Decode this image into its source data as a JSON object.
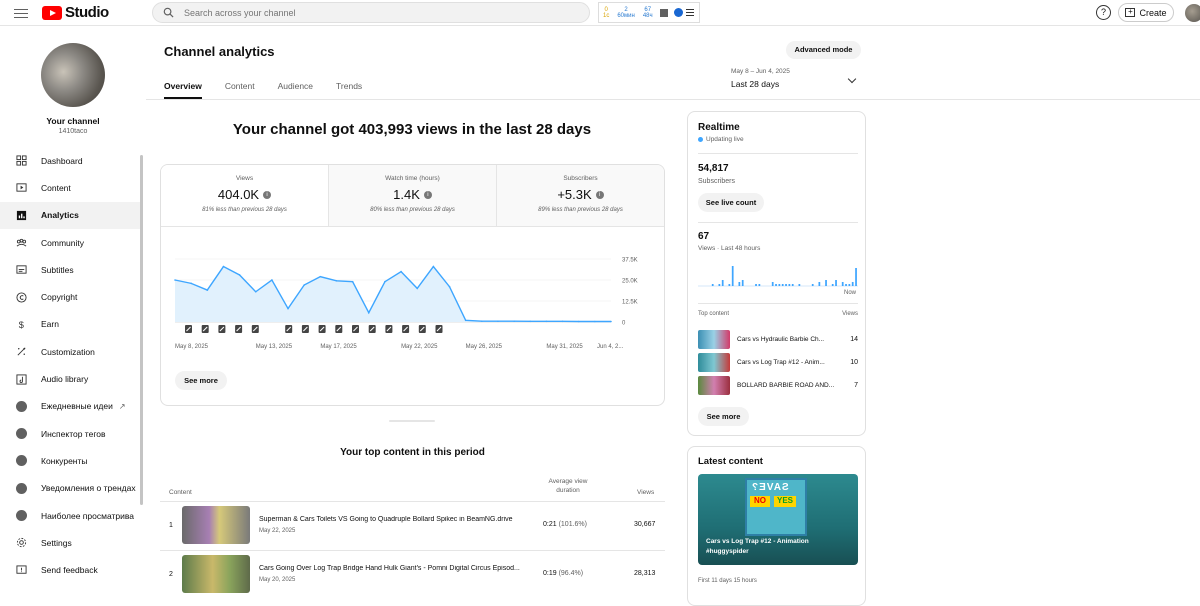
{
  "topbar": {
    "brand": "Studio",
    "search_placeholder": "Search across your channel",
    "ext_stats": [
      {
        "value": "0",
        "label": "1с"
      },
      {
        "value": "2",
        "label": "60мин"
      },
      {
        "value": "67",
        "label": "48ч"
      }
    ],
    "help_label": "?",
    "create_label": "Create"
  },
  "sidebar": {
    "channel_label": "Your channel",
    "channel_handle": "1410taco",
    "items": [
      {
        "label": "Dashboard",
        "icon": "dashboard-icon"
      },
      {
        "label": "Content",
        "icon": "content-icon"
      },
      {
        "label": "Analytics",
        "icon": "analytics-icon",
        "active": true
      },
      {
        "label": "Community",
        "icon": "community-icon"
      },
      {
        "label": "Subtitles",
        "icon": "subtitles-icon"
      },
      {
        "label": "Copyright",
        "icon": "copyright-icon"
      },
      {
        "label": "Earn",
        "icon": "earn-icon"
      },
      {
        "label": "Customization",
        "icon": "customization-icon"
      },
      {
        "label": "Audio library",
        "icon": "audio-library-icon"
      },
      {
        "label": "Ежедневные идеи",
        "icon": "extension-icon"
      },
      {
        "label": "Инспектор тегов",
        "icon": "extension-icon"
      },
      {
        "label": "Конкуренты",
        "icon": "extension-icon"
      },
      {
        "label": "Уведомления о трендах",
        "icon": "extension-icon"
      },
      {
        "label": "Наиболее просматрива",
        "icon": "extension-icon"
      },
      {
        "label": "Settings",
        "icon": "settings-icon"
      },
      {
        "label": "Send feedback",
        "icon": "feedback-icon"
      }
    ]
  },
  "main": {
    "title": "Channel analytics",
    "advanced_mode": "Advanced mode",
    "tabs": [
      "Overview",
      "Content",
      "Audience",
      "Trends"
    ],
    "date_range_small": "May 8 – Jun 4, 2025",
    "date_range_label": "Last 28 days",
    "headline": "Your channel got 403,993 views in the last 28 days",
    "kpis": [
      {
        "label": "Views",
        "value": "404.0K",
        "sub": "81% less than previous 28 days"
      },
      {
        "label": "Watch time (hours)",
        "value": "1.4K",
        "sub": "80% less than previous 28 days"
      },
      {
        "label": "Subscribers",
        "value": "+5.3K",
        "sub": "89% less than previous 28 days"
      }
    ],
    "see_more": "See more",
    "top_content_title": "Your top content in this period",
    "top_content_headers": {
      "content": "Content",
      "avg_duration": "Average view duration",
      "views": "Views"
    },
    "top_content": [
      {
        "rank": "1",
        "title": "Superman & Cars Toilets VS Going to Quadruple Bollard Spikec in BeamNG.drive",
        "date": "May 22, 2025",
        "duration": "0:21",
        "duration_pct": "(101.6%)",
        "views": "30,667"
      },
      {
        "rank": "2",
        "title": "Cars Going Over Log Trap Bridge Hand Hulk Giant's - Pomni Digital Circus Episod...",
        "date": "May 20, 2025",
        "duration": "0:19",
        "duration_pct": "(96.4%)",
        "views": "28,313"
      }
    ]
  },
  "chart_data": {
    "type": "line",
    "x": [
      "May 8, 2025",
      "May 9",
      "May 10",
      "May 11",
      "May 12",
      "May 13, 2025",
      "May 14",
      "May 15",
      "May 16",
      "May 17, 2025",
      "May 18",
      "May 19",
      "May 20",
      "May 21",
      "May 22, 2025",
      "May 23",
      "May 24",
      "May 25",
      "May 26, 2025",
      "May 27",
      "May 28",
      "May 29",
      "May 30",
      "May 31, 2025",
      "Jun 1",
      "Jun 2",
      "Jun 3",
      "Jun 4, 2..."
    ],
    "x_tick_labels": [
      "May 8, 2025",
      "May 13, 2025",
      "May 17, 2025",
      "May 22, 2025",
      "May 26, 2025",
      "May 31, 2025",
      "Jun 4, 2..."
    ],
    "series": [
      {
        "values": [
          25000,
          23000,
          19000,
          33000,
          28000,
          18000,
          25000,
          8000,
          22000,
          27000,
          24500,
          24000,
          5500,
          24000,
          30000,
          20000,
          33000,
          21000,
          1000,
          500,
          500,
          500,
          400,
          400,
          400,
          300,
          300,
          300
        ]
      }
    ],
    "y_ticks": [
      "37.5K",
      "25.0K",
      "12.5K",
      "0"
    ],
    "ylim": [
      0,
      37500
    ],
    "color": "#3ea6ff",
    "fill": "#e1f1fd"
  },
  "realtime": {
    "title": "Realtime",
    "status": "Updating live",
    "subscribers": "54,817",
    "subscribers_label": "Subscribers",
    "see_live_count": "See live count",
    "views": "67",
    "views_label": "Views · Last 48 hours",
    "now_label": "Now",
    "bars": [
      0,
      0,
      0,
      0,
      1,
      0,
      1,
      3,
      0,
      1,
      10,
      0,
      2,
      3,
      0,
      0,
      0,
      1,
      1,
      0,
      0,
      0,
      2,
      1,
      1,
      1,
      1,
      1,
      1,
      0,
      1,
      0,
      0,
      0,
      1,
      0,
      2,
      0,
      3,
      0,
      1,
      3,
      0,
      2,
      1,
      1,
      2,
      9
    ],
    "top_content_label": "Top content",
    "top_views_label": "Views",
    "items": [
      {
        "title": "Cars vs Hydraulic Barbie Ch...",
        "views": "14"
      },
      {
        "title": "Cars vs Log Trap #12 - Anim...",
        "views": "10"
      },
      {
        "title": "BOLLARD BARBIE ROAD AND...",
        "views": "7"
      }
    ],
    "see_more": "See more"
  },
  "latest": {
    "title": "Latest content",
    "thumb_top": "SAVE?",
    "thumb_no": "NO",
    "thumb_yes": "YES",
    "caption": "Cars vs Log Trap #12 - Animation",
    "caption_tag": "#huggyspider",
    "first_label": "First 11 days 15 hours"
  }
}
